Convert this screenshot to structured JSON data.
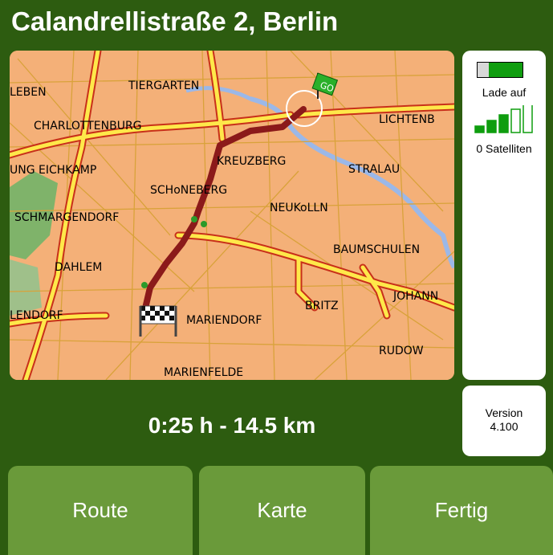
{
  "header": {
    "title": "Calandrellistraße 2, Berlin"
  },
  "status": {
    "battery_label": "Lade auf",
    "battery_level": 0.75,
    "satellites_label": "0 Satelliten",
    "signal_bars_filled": 3,
    "signal_bars_total": 5
  },
  "version": {
    "label": "Version",
    "number": "4.100"
  },
  "summary": {
    "text": "0:25 h - 14.5 km"
  },
  "buttons": {
    "route": "Route",
    "map": "Karte",
    "done": "Fertig"
  },
  "map": {
    "destination_sign": "GO",
    "labels": {
      "tiergarten": "TIERGARTEN",
      "leben": "LEBEN",
      "charlottenburg": "CHARLOTTENBURG",
      "lichtenb": "LICHTENB",
      "eichkamp": "UNG EICHKAMP",
      "kreuzberg": "KREUZBERG",
      "stralau": "STRALAU",
      "schoneberg": "SCHoNEBERG",
      "neukolln": "NEUKoLLN",
      "schmargendorf": "SCHMARGENDORF",
      "baumschulen": "BAUMSCHULEN",
      "dahlem": "DAHLEM",
      "johann": "JOHANN",
      "britz": "BRITZ",
      "lendorf": "LENDORF",
      "mariendorf": "MARIENDORF",
      "rudow": "RUDOW",
      "marienfelde": "MARIENFELDE"
    }
  },
  "colors": {
    "background": "#2d5c10",
    "button": "#6a9a3a",
    "map_land": "#f4b078",
    "route": "#8b1a1a",
    "battery_fill": "#0f9d0f"
  }
}
